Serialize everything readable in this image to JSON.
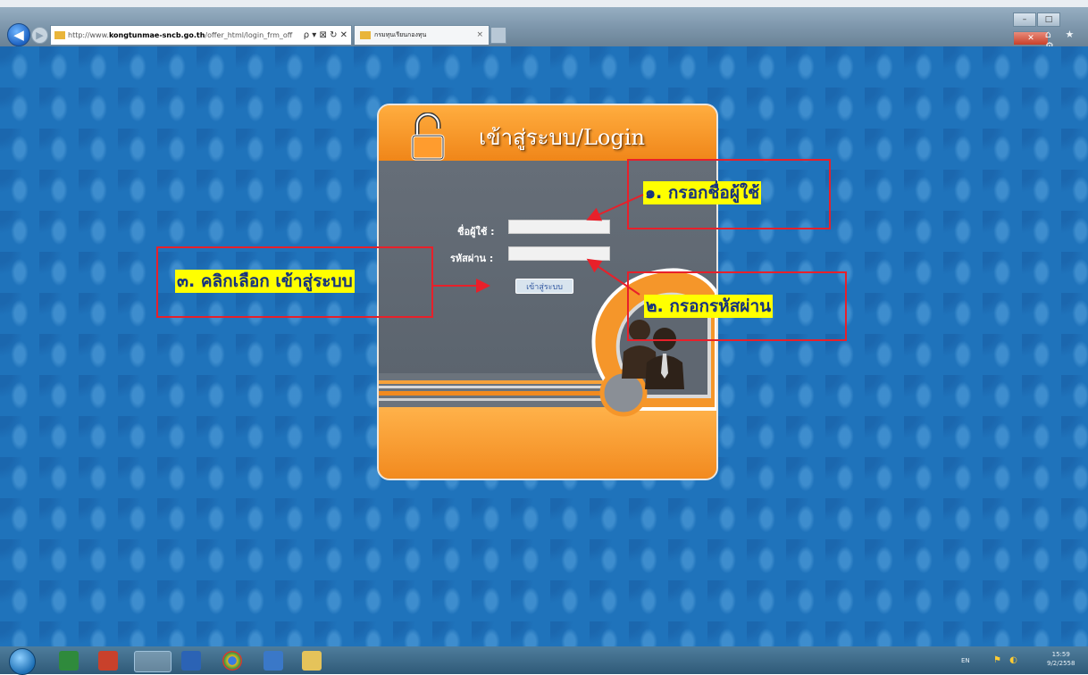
{
  "browser": {
    "address_prefix": "http://www.",
    "address_host": "kongtunmae-sncb.go.th",
    "address_path": "/offer_html/login_frm_off",
    "address_tools": "ρ ▾ ⊠ ↻ ✕",
    "tab_title": "กรมทุนเรียนกองทุน",
    "tab_close": "×",
    "win_min": "–",
    "win_max": "□",
    "win_close": "✕",
    "right_icons": "⌂ ★ ⚙",
    "back_icon": "back-arrow-icon",
    "forward_icon": "forward-arrow-icon"
  },
  "login": {
    "title": "เข้าสู่ระบบ/Login",
    "username_label": "ชื่อผู้ใช้ :",
    "password_label": "รหัสผ่าน :",
    "username_value": "",
    "password_value": "",
    "login_button": "เข้าสู่ระบบ"
  },
  "annotations": {
    "step1": "๑. กรอกชื่อผู้ใช้",
    "step2": "๒. กรอกรหัสผ่าน",
    "step3": "๓. คลิกเลือก เข้าสู่ระบบ"
  },
  "taskbar": {
    "language": "EN",
    "time": "15:59",
    "date": "9/2/2558"
  },
  "colors": {
    "page_background": "#1f73bb",
    "card_orange": "#ff9c2e",
    "card_gray": "#5f6771",
    "annotation_border": "#e8202a",
    "annotation_highlight": "#ffff00",
    "annotation_text": "#17337d"
  }
}
